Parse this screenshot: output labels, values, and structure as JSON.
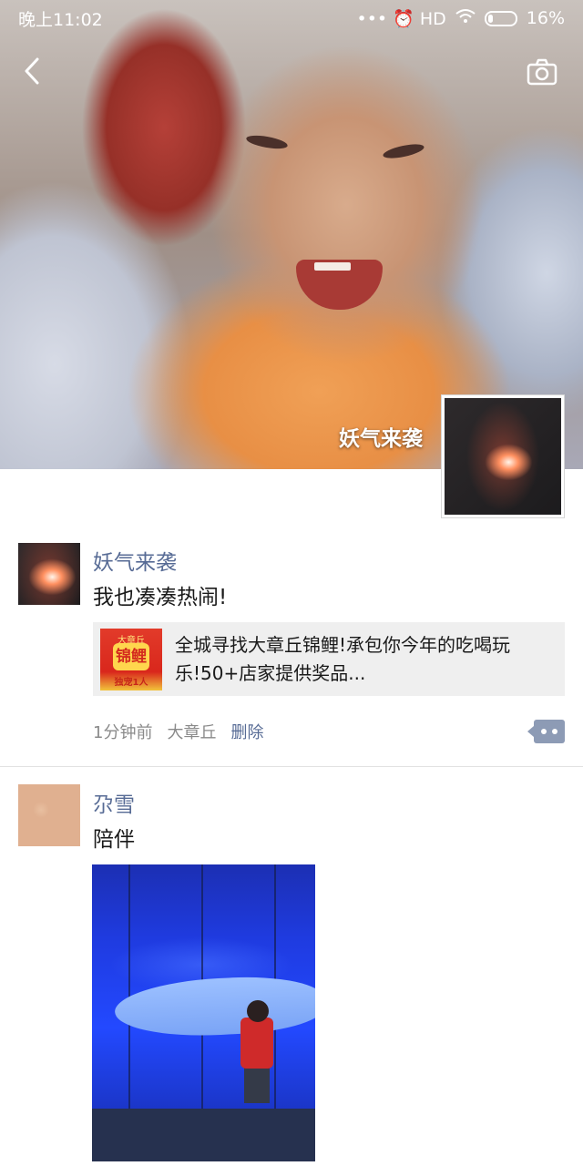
{
  "status_bar": {
    "time": "晚上11:02",
    "signals": "••• ⏰ HD",
    "battery": "16%"
  },
  "header": {
    "back_icon": "back-chevron-icon",
    "camera_icon": "camera-icon"
  },
  "cover": {
    "user_name": "妖气来袭"
  },
  "posts": [
    {
      "name": "妖气来袭",
      "text": "我也凑凑热闹!",
      "link": {
        "title": "全城寻找大章丘锦鲤!承包你今年的吃喝玩乐!50+店家提供奖品...",
        "thumb_top": "大章丘",
        "thumb_main": "锦鲤",
        "thumb_bottom": "独宠1人"
      },
      "meta": {
        "time": "1分钟前",
        "location": "大章丘",
        "delete_label": "删除"
      }
    },
    {
      "name": "尕雪",
      "text": "陪伴"
    }
  ],
  "colors": {
    "link_blue": "#576b95",
    "more_button": "#8d9bb5"
  }
}
